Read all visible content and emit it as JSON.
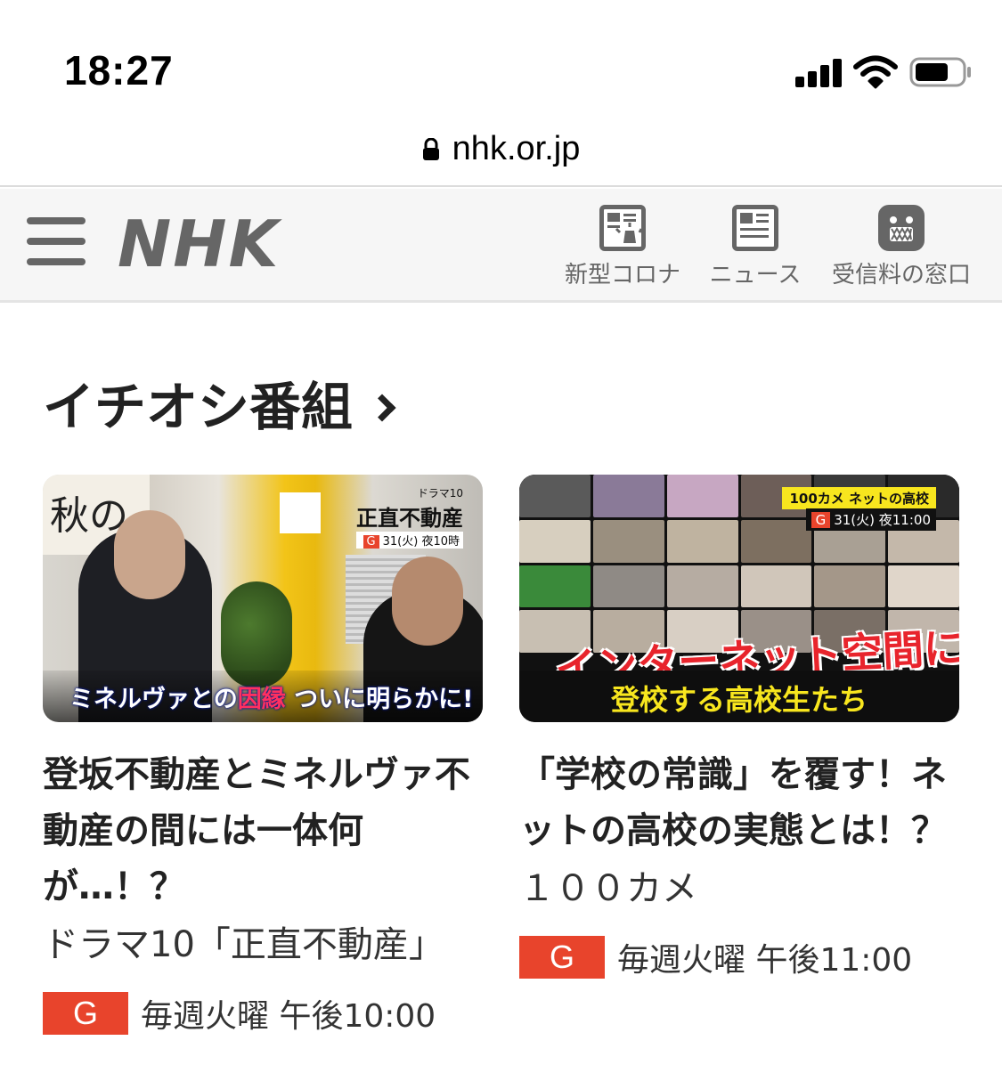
{
  "status_bar": {
    "time": "18:27"
  },
  "browser": {
    "url": "nhk.or.jp"
  },
  "header": {
    "logo": "NHK",
    "nav": [
      {
        "label": "新型コロナ",
        "icon": "news-alert-icon"
      },
      {
        "label": "ニュース",
        "icon": "newspaper-icon"
      },
      {
        "label": "受信料の窓口",
        "icon": "domo-kun-icon"
      }
    ]
  },
  "section": {
    "title": "イチオシ番組"
  },
  "cards": [
    {
      "thumb": {
        "sign": "秋の",
        "drama_small": "ドラマ10",
        "drama_title": "正直不動産",
        "badge": "G",
        "air": "31(火) 夜10時",
        "caption_a": "ミネルヴァとの",
        "caption_b": "因縁",
        "caption_c": " ついに明らかに!"
      },
      "title": "登坂不動産とミネルヴァ不動産の間には一体何が…！？",
      "program": "ドラマ10「正直不動産」",
      "channel": "G",
      "schedule": "毎週火曜 午後10:00"
    },
    {
      "thumb": {
        "show": "100カメ ネットの高校",
        "badge": "G",
        "air": "31(火) 夜11:00",
        "headline": "インターネット空間に",
        "subline": "登校する高校生たち"
      },
      "title": "「学校の常識」を覆す！ネットの高校の実態とは！？",
      "program": "１００カメ",
      "channel": "G",
      "schedule": "毎週火曜 午後11:00"
    }
  ],
  "colors": {
    "badge": "#e8442c",
    "header_bg": "#f6f6f6",
    "header_text": "#666666"
  }
}
